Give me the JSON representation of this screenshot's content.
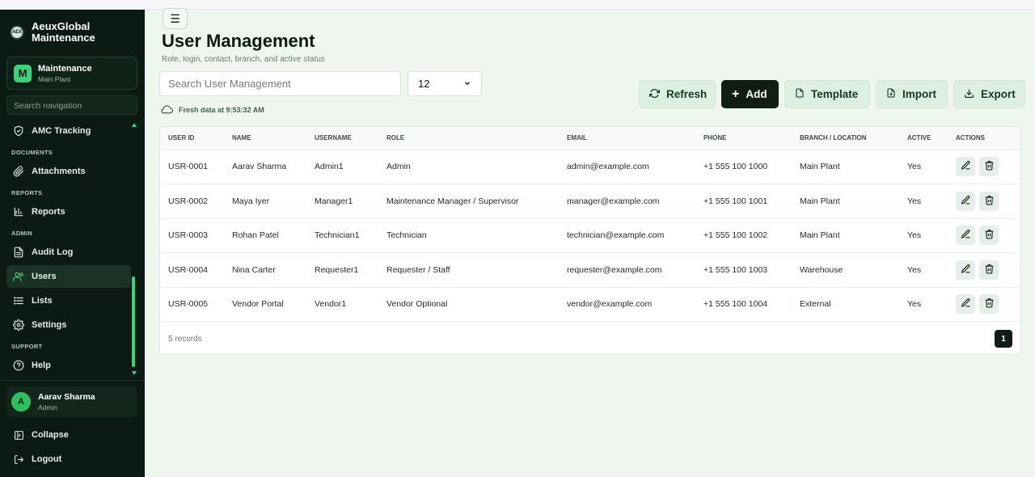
{
  "sidebar": {
    "brand": {
      "line1": "AeuxGlobal",
      "line2": "Maintenance"
    },
    "workspace": {
      "badge": "M",
      "title": "Maintenance",
      "subtitle": "Main Plant"
    },
    "search_placeholder": "Search navigation",
    "items": [
      {
        "type": "item",
        "label": "AMC Tracking",
        "icon": "shield-check-icon"
      },
      {
        "type": "section",
        "label": "DOCUMENTS"
      },
      {
        "type": "item",
        "label": "Attachments",
        "icon": "paperclip-icon"
      },
      {
        "type": "section",
        "label": "REPORTS"
      },
      {
        "type": "item",
        "label": "Reports",
        "icon": "bar-chart-icon"
      },
      {
        "type": "section",
        "label": "ADMIN"
      },
      {
        "type": "item",
        "label": "Audit Log",
        "icon": "file-text-icon"
      },
      {
        "type": "item",
        "label": "Users",
        "icon": "users-icon",
        "active": true
      },
      {
        "type": "item",
        "label": "Lists",
        "icon": "list-icon"
      },
      {
        "type": "item",
        "label": "Settings",
        "icon": "gear-icon"
      },
      {
        "type": "section",
        "label": "SUPPORT"
      },
      {
        "type": "item",
        "label": "Help",
        "icon": "help-circle-icon"
      }
    ],
    "user": {
      "initial": "A",
      "name": "Aarav Sharma",
      "role": "Admin"
    },
    "collapse_label": "Collapse",
    "logout_label": "Logout"
  },
  "page": {
    "title": "User Management",
    "subtitle": "Role, login, contact, branch, and active status",
    "search_placeholder": "Search User Management",
    "page_size": "12",
    "fresh_text": "Fresh data at 9:53:32 AM"
  },
  "toolbar": {
    "refresh": "Refresh",
    "add": "Add",
    "template": "Template",
    "import": "Import",
    "export": "Export"
  },
  "table": {
    "columns": [
      "USER ID",
      "NAME",
      "USERNAME",
      "ROLE",
      "EMAIL",
      "PHONE",
      "BRANCH / LOCATION",
      "ACTIVE",
      "ACTIONS"
    ],
    "rows": [
      [
        "USR-0001",
        "Aarav Sharma",
        "Admin1",
        "Admin",
        "admin@example.com",
        "+1 555 100 1000",
        "Main Plant",
        "Yes"
      ],
      [
        "USR-0002",
        "Maya Iyer",
        "Manager1",
        "Maintenance Manager / Supervisor",
        "manager@example.com",
        "+1 555 100 1001",
        "Main Plant",
        "Yes"
      ],
      [
        "USR-0003",
        "Rohan Patel",
        "Technician1",
        "Technician",
        "technician@example.com",
        "+1 555 100 1002",
        "Main Plant",
        "Yes"
      ],
      [
        "USR-0004",
        "Nina Carter",
        "Requester1",
        "Requester / Staff",
        "requester@example.com",
        "+1 555 100 1003",
        "Warehouse",
        "Yes"
      ],
      [
        "USR-0005",
        "Vendor Portal",
        "Vendor1",
        "Vendor Optional",
        "vendor@example.com",
        "+1 555 100 1004",
        "External",
        "Yes"
      ]
    ],
    "records_text": "5 records",
    "current_page": "1"
  },
  "colors": {
    "sidebar_bg": "#0b1a12",
    "accent": "#3fd07a",
    "page_bg": "#eef6ee",
    "primary_button": "#0f1d15"
  }
}
